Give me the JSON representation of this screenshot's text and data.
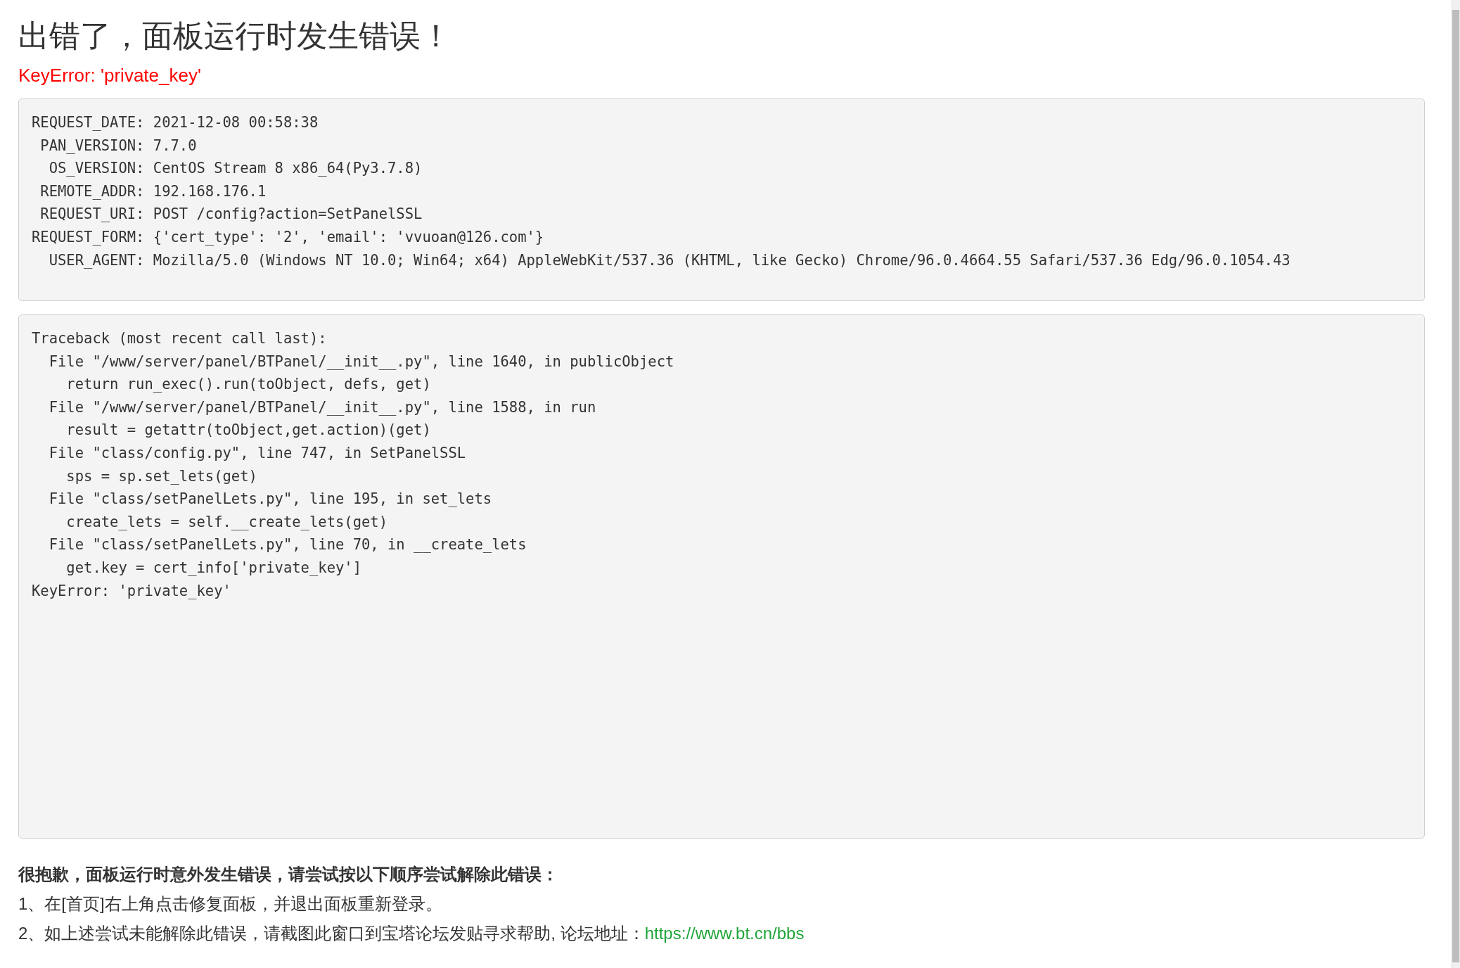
{
  "title": "出错了，面板运行时发生错误！",
  "error_message": "KeyError: 'private_key'",
  "request_info": {
    "lines": [
      "REQUEST_DATE: 2021-12-08 00:58:38",
      " PAN_VERSION: 7.7.0",
      "  OS_VERSION: CentOS Stream 8 x86_64(Py3.7.8)",
      " REMOTE_ADDR: 192.168.176.1",
      " REQUEST_URI: POST /config?action=SetPanelSSL",
      "REQUEST_FORM: {'cert_type': '2', 'email': 'vvuoan@126.com'}",
      "  USER_AGENT: Mozilla/5.0 (Windows NT 10.0; Win64; x64) AppleWebKit/537.36 (KHTML, like Gecko) Chrome/96.0.4664.55 Safari/537.36 Edg/96.0.1054.43"
    ]
  },
  "traceback": {
    "lines": [
      "Traceback (most recent call last):",
      "  File \"/www/server/panel/BTPanel/__init__.py\", line 1640, in publicObject",
      "    return run_exec().run(toObject, defs, get)",
      "  File \"/www/server/panel/BTPanel/__init__.py\", line 1588, in run",
      "    result = getattr(toObject,get.action)(get)",
      "  File \"class/config.py\", line 747, in SetPanelSSL",
      "    sps = sp.set_lets(get)",
      "  File \"class/setPanelLets.py\", line 195, in set_lets",
      "    create_lets = self.__create_lets(get)",
      "  File \"class/setPanelLets.py\", line 70, in __create_lets",
      "    get.key = cert_info['private_key']",
      "KeyError: 'private_key'"
    ]
  },
  "help": {
    "heading": "很抱歉，面板运行时意外发生错误，请尝试按以下顺序尝试解除此错误：",
    "steps": [
      {
        "text": "1、在[首页]右上角点击修复面板，并退出面板重新登录。"
      },
      {
        "text": "2、如上述尝试未能解除此错误，请截图此窗口到宝塔论坛发贴寻求帮助, 论坛地址：",
        "link": "https://www.bt.cn/bbs"
      }
    ]
  }
}
